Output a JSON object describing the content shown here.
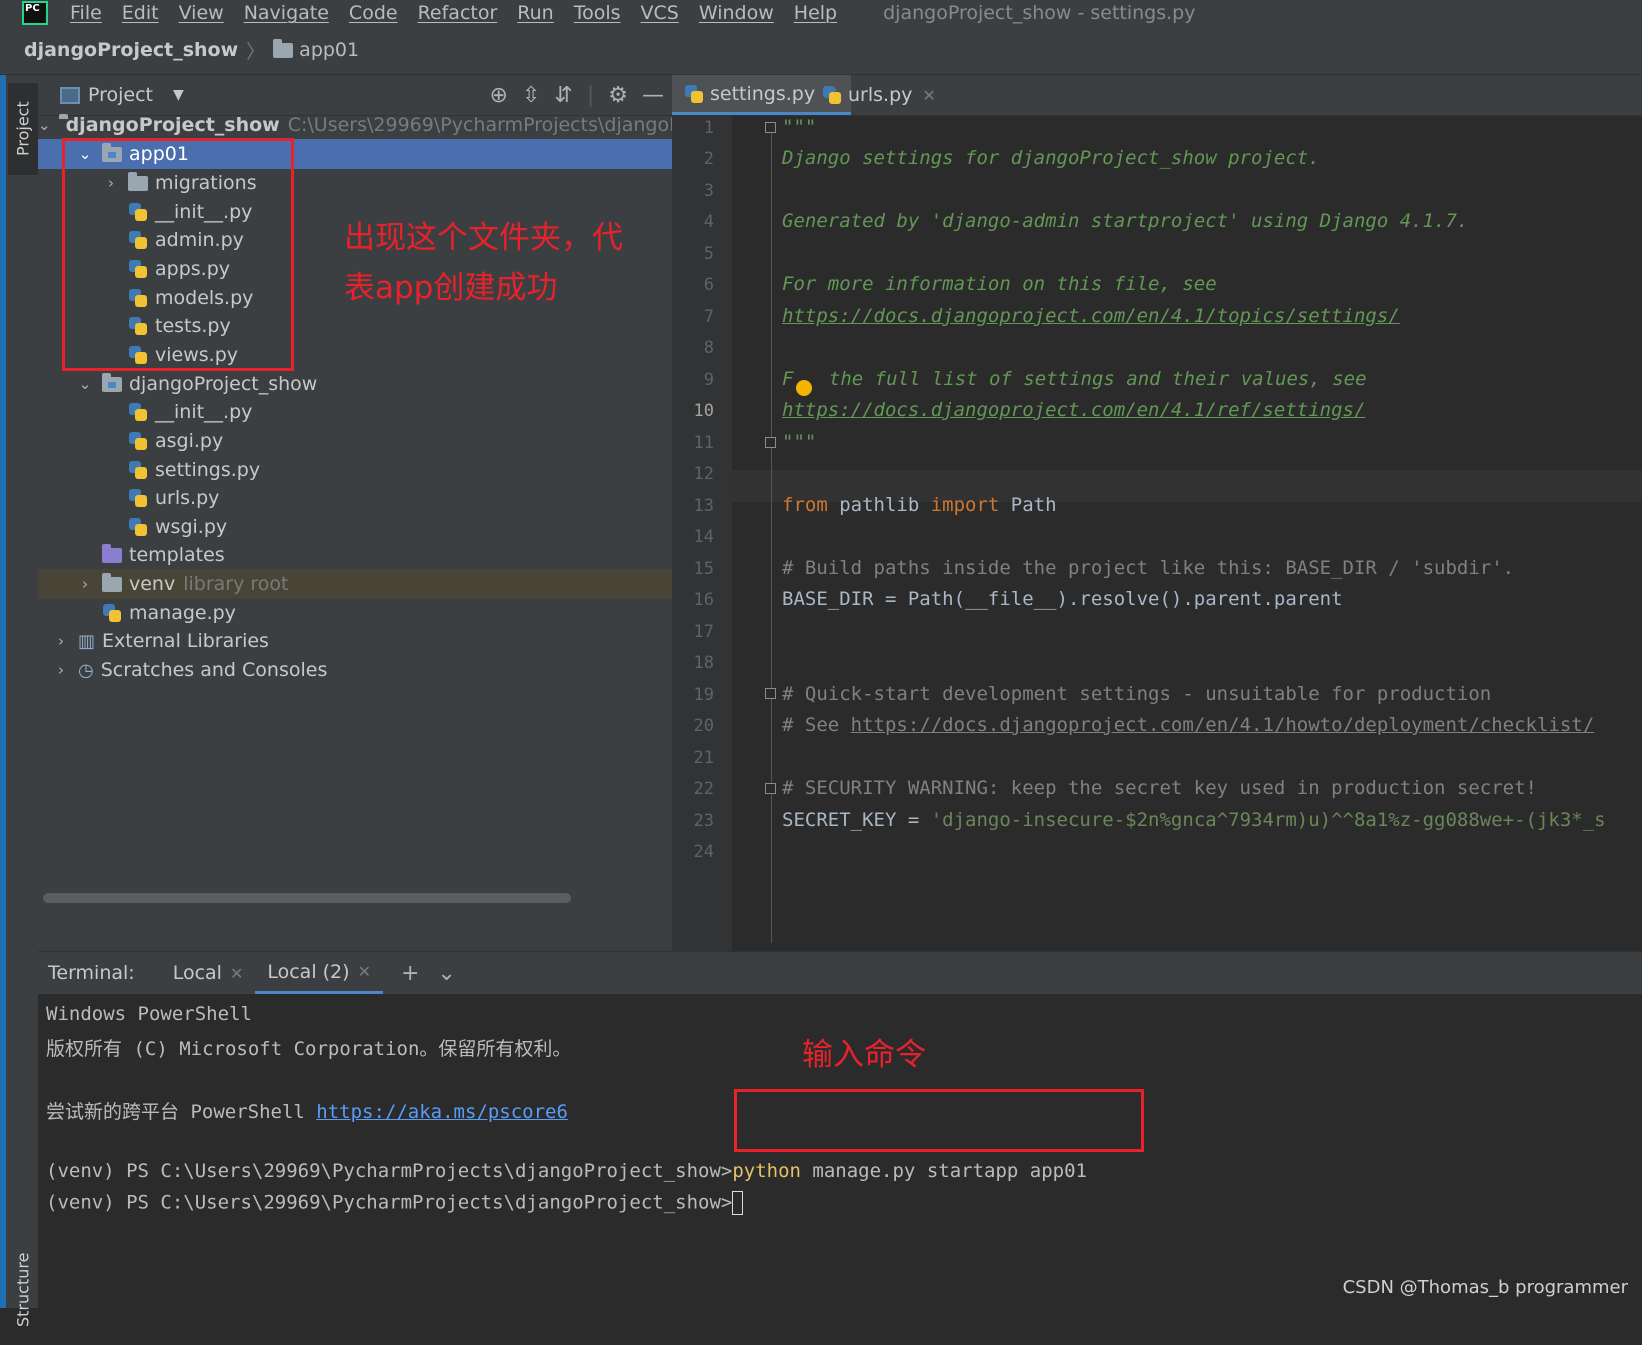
{
  "menubar": {
    "logo_text": "PC",
    "items": [
      "File",
      "Edit",
      "View",
      "Navigate",
      "Code",
      "Refactor",
      "Run",
      "Tools",
      "VCS",
      "Window",
      "Help"
    ],
    "window_title": "djangoProject_show - settings.py"
  },
  "breadcrumb": {
    "project": "djangoProject_show",
    "folder": "app01"
  },
  "sidebar": {
    "project_tab": "Project",
    "structure_tab": "Structure"
  },
  "project_panel": {
    "title": "Project",
    "tree": [
      {
        "label": "djangoProject_show",
        "hint": "C:\\Users\\29969\\PycharmProjects\\djangoPro",
        "icon": "folder-icon"
      },
      {
        "label": "app01",
        "icon": "folder-icon"
      },
      {
        "label": "migrations",
        "icon": "folder-icon"
      },
      {
        "label": "__init__.py",
        "icon": "python-file-icon"
      },
      {
        "label": "admin.py",
        "icon": "python-file-icon"
      },
      {
        "label": "apps.py",
        "icon": "python-file-icon"
      },
      {
        "label": "models.py",
        "icon": "python-file-icon"
      },
      {
        "label": "tests.py",
        "icon": "python-file-icon"
      },
      {
        "label": "views.py",
        "icon": "python-file-icon"
      },
      {
        "label": "djangoProject_show",
        "icon": "folder-icon"
      },
      {
        "label": "__init__.py",
        "icon": "python-file-icon"
      },
      {
        "label": "asgi.py",
        "icon": "python-file-icon"
      },
      {
        "label": "settings.py",
        "icon": "python-file-icon"
      },
      {
        "label": "urls.py",
        "icon": "python-file-icon"
      },
      {
        "label": "wsgi.py",
        "icon": "python-file-icon"
      },
      {
        "label": "templates",
        "icon": "folder-icon"
      },
      {
        "label": "venv",
        "hint": "library root",
        "icon": "folder-icon"
      },
      {
        "label": "manage.py",
        "icon": "python-file-icon"
      },
      {
        "label": "External Libraries",
        "icon": "library-icon"
      },
      {
        "label": "Scratches and Consoles",
        "icon": "scratches-icon"
      }
    ]
  },
  "annotations": {
    "folder_note_line1": "出现这个文件夹，代",
    "folder_note_line2": "表app创建成功",
    "command_note": "输入命令"
  },
  "editor": {
    "tabs": [
      {
        "label": "settings.py",
        "active": true
      },
      {
        "label": "urls.py",
        "active": false
      }
    ],
    "current_line": 10,
    "line_numbers": [
      "1",
      "2",
      "3",
      "4",
      "5",
      "6",
      "7",
      "8",
      "9",
      "10",
      "11",
      "12",
      "13",
      "14",
      "15",
      "16",
      "17",
      "18",
      "19",
      "20",
      "21",
      "22",
      "23",
      "24"
    ],
    "code": {
      "l1": "\"\"\"",
      "l2": "Django settings for djangoProject_show project.",
      "l4": "Generated by 'django-admin startproject' using Django 4.1.7.",
      "l6": "For more information on this file, see",
      "l7": "https://docs.djangoproject.com/en/4.1/topics/settings/",
      "l9a": "F",
      "l9b": " the full list of settings and their values, see",
      "l10": "https://docs.djangoproject.com/en/4.1/ref/settings/",
      "l11": "\"\"\"",
      "l13_kw1": "from",
      "l13_mod": " pathlib ",
      "l13_kw2": "import",
      "l13_name": " Path",
      "l15": "# Build paths inside the project like this: BASE_DIR / 'subdir'.",
      "l16": "BASE_DIR = Path(__file__).resolve().parent.parent",
      "l19": "# Quick-start development settings - unsuitable for production",
      "l20a": "# See ",
      "l20b": "https://docs.djangoproject.com/en/4.1/howto/deployment/checklist/",
      "l22": "# SECURITY WARNING: keep the secret key used in production secret!",
      "l23a": "SECRET_KEY = ",
      "l23b": "'django-insecure-$2n%gnca^7934rm)u)^^8a1%z-gg088we+-(jk3*_s"
    }
  },
  "terminal": {
    "label": "Terminal:",
    "tabs": [
      {
        "label": "Local",
        "active": false
      },
      {
        "label": "Local (2)",
        "active": true
      }
    ],
    "lines": {
      "l1": "Windows PowerShell",
      "l2": "版权所有 (C) Microsoft Corporation。保留所有权利。",
      "l3a": "尝试新的跨平台 PowerShell ",
      "l3b": "https://aka.ms/pscore6",
      "prompt": "(venv) PS C:\\Users\\29969\\PycharmProjects\\djangoProject_show>",
      "cmd_kw": "python",
      "cmd_rest": " manage.py startapp app01"
    }
  },
  "watermark": "CSDN @Thomas_b programmer",
  "colors": {
    "accent": "#4b6eaf",
    "annotation": "#e8222a",
    "docstring": "#629755",
    "keyword": "#cc7832",
    "link": "#589df6"
  }
}
